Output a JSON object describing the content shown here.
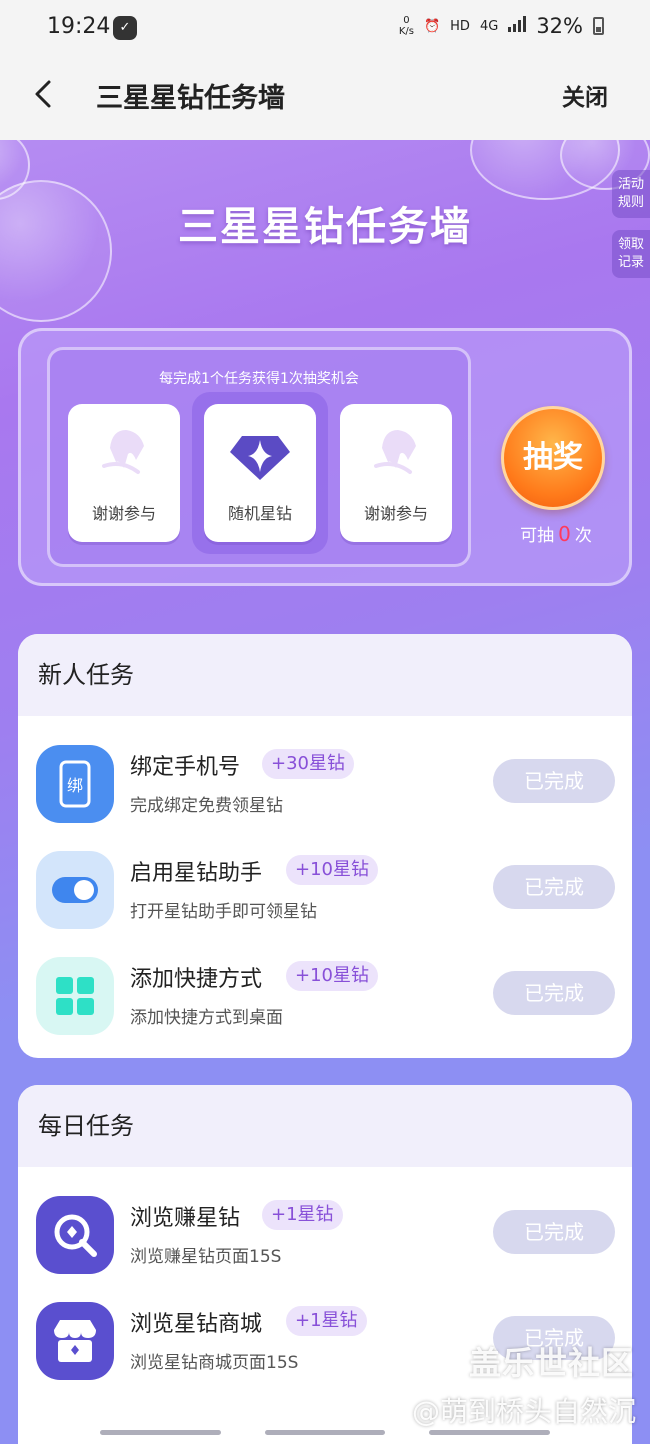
{
  "status_bar": {
    "time": "19:24",
    "net_speed_value": "0",
    "net_speed_unit": "K/s",
    "hd": "HD",
    "network": "4G",
    "battery": "32%"
  },
  "app_bar": {
    "title": "三星星钻任务墙",
    "close_label": "关闭"
  },
  "hero": {
    "title": "三星星钻任务墙",
    "side_tabs": [
      "活动规则",
      "领取记录"
    ]
  },
  "lottery": {
    "tip": "每完成1个任务获得1次抽奖机会",
    "prizes": [
      {
        "label": "谢谢参与",
        "icon": "thanks-icon"
      },
      {
        "label": "随机星钻",
        "icon": "diamond-icon"
      },
      {
        "label": "谢谢参与",
        "icon": "thanks-icon"
      }
    ],
    "draw_label": "抽奖",
    "count_prefix": "可抽",
    "count_value": "0",
    "count_suffix": "次"
  },
  "new_tasks": {
    "title": "新人任务",
    "items": [
      {
        "name": "绑定手机号",
        "badge": "+30星钻",
        "desc": "完成绑定免费领星钻",
        "status": "已完成",
        "icon": "phone-bind-icon"
      },
      {
        "name": "启用星钻助手",
        "badge": "+10星钻",
        "desc": "打开星钻助手即可领星钻",
        "status": "已完成",
        "icon": "toggle-icon"
      },
      {
        "name": "添加快捷方式",
        "badge": "+10星钻",
        "desc": "添加快捷方式到桌面",
        "status": "已完成",
        "icon": "grid-shortcut-icon"
      }
    ]
  },
  "daily_tasks": {
    "title": "每日任务",
    "items": [
      {
        "name": "浏览赚星钻",
        "badge": "+1星钻",
        "desc": "浏览赚星钻页面15S",
        "status": "已完成",
        "icon": "search-diamond-icon"
      },
      {
        "name": "浏览星钻商城",
        "badge": "+1星钻",
        "desc": "浏览星钻商城页面15S",
        "status": "已完成",
        "icon": "store-icon"
      }
    ]
  },
  "watermark": {
    "line1": "盖乐世社区",
    "line2": "@萌到桥头自然沉"
  },
  "colors": {
    "accent": "#8850d8",
    "badge_bg": "#ece3fb",
    "done_bg": "#d7d8ee",
    "draw_orange": "#ff7a1a"
  }
}
